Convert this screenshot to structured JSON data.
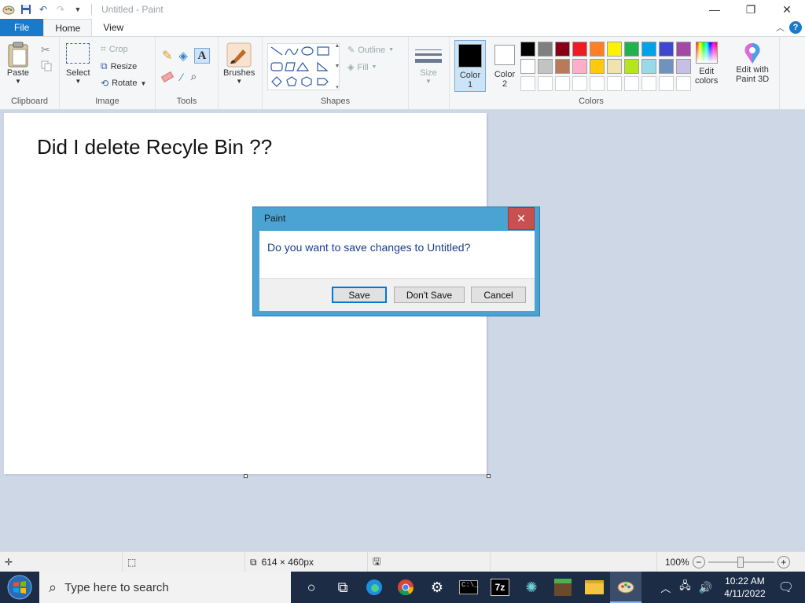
{
  "window": {
    "title": "Untitled - Paint",
    "minimize": "—",
    "maximize": "❐",
    "close": "✕"
  },
  "tabs": [
    "File",
    "Home",
    "View"
  ],
  "ribbon": {
    "clipboard": {
      "label": "Clipboard",
      "paste": "Paste"
    },
    "image": {
      "label": "Image",
      "select": "Select",
      "crop": "Crop",
      "resize": "Resize",
      "rotate": "Rotate"
    },
    "tools": {
      "label": "Tools"
    },
    "brushes": "Brushes",
    "shapes": {
      "label": "Shapes",
      "outline": "Outline",
      "fill": "Fill"
    },
    "size": "Size",
    "color1": [
      "Color",
      "1"
    ],
    "color2": [
      "Color",
      "2"
    ],
    "colors_label": "Colors",
    "edit_colors": [
      "Edit",
      "colors"
    ],
    "paint3d": [
      "Edit with",
      "Paint 3D"
    ],
    "palette_row1": [
      "#000000",
      "#7f7f7f",
      "#880015",
      "#ed1c24",
      "#ff7f27",
      "#fff200",
      "#22b14c",
      "#00a2e8",
      "#3f48cc",
      "#a349a4"
    ],
    "palette_row2": [
      "#ffffff",
      "#c3c3c3",
      "#b97a57",
      "#ffaec9",
      "#ffc90e",
      "#efe4b0",
      "#b5e61d",
      "#99d9ea",
      "#7092be",
      "#c8bfe7"
    ],
    "color1_value": "#000000",
    "color2_value": "#ffffff"
  },
  "canvas": {
    "text": "Did I delete Recyle Bin ??"
  },
  "dialog": {
    "title": "Paint",
    "close": "✕",
    "message": "Do you want to save changes to Untitled?",
    "save": "Save",
    "dont_save": "Don't Save",
    "cancel": "Cancel"
  },
  "status": {
    "dimensions": "614 × 460px",
    "zoom": "100%"
  },
  "taskbar": {
    "search_placeholder": "Type here to search",
    "time": "10:22 AM",
    "date": "4/11/2022"
  }
}
